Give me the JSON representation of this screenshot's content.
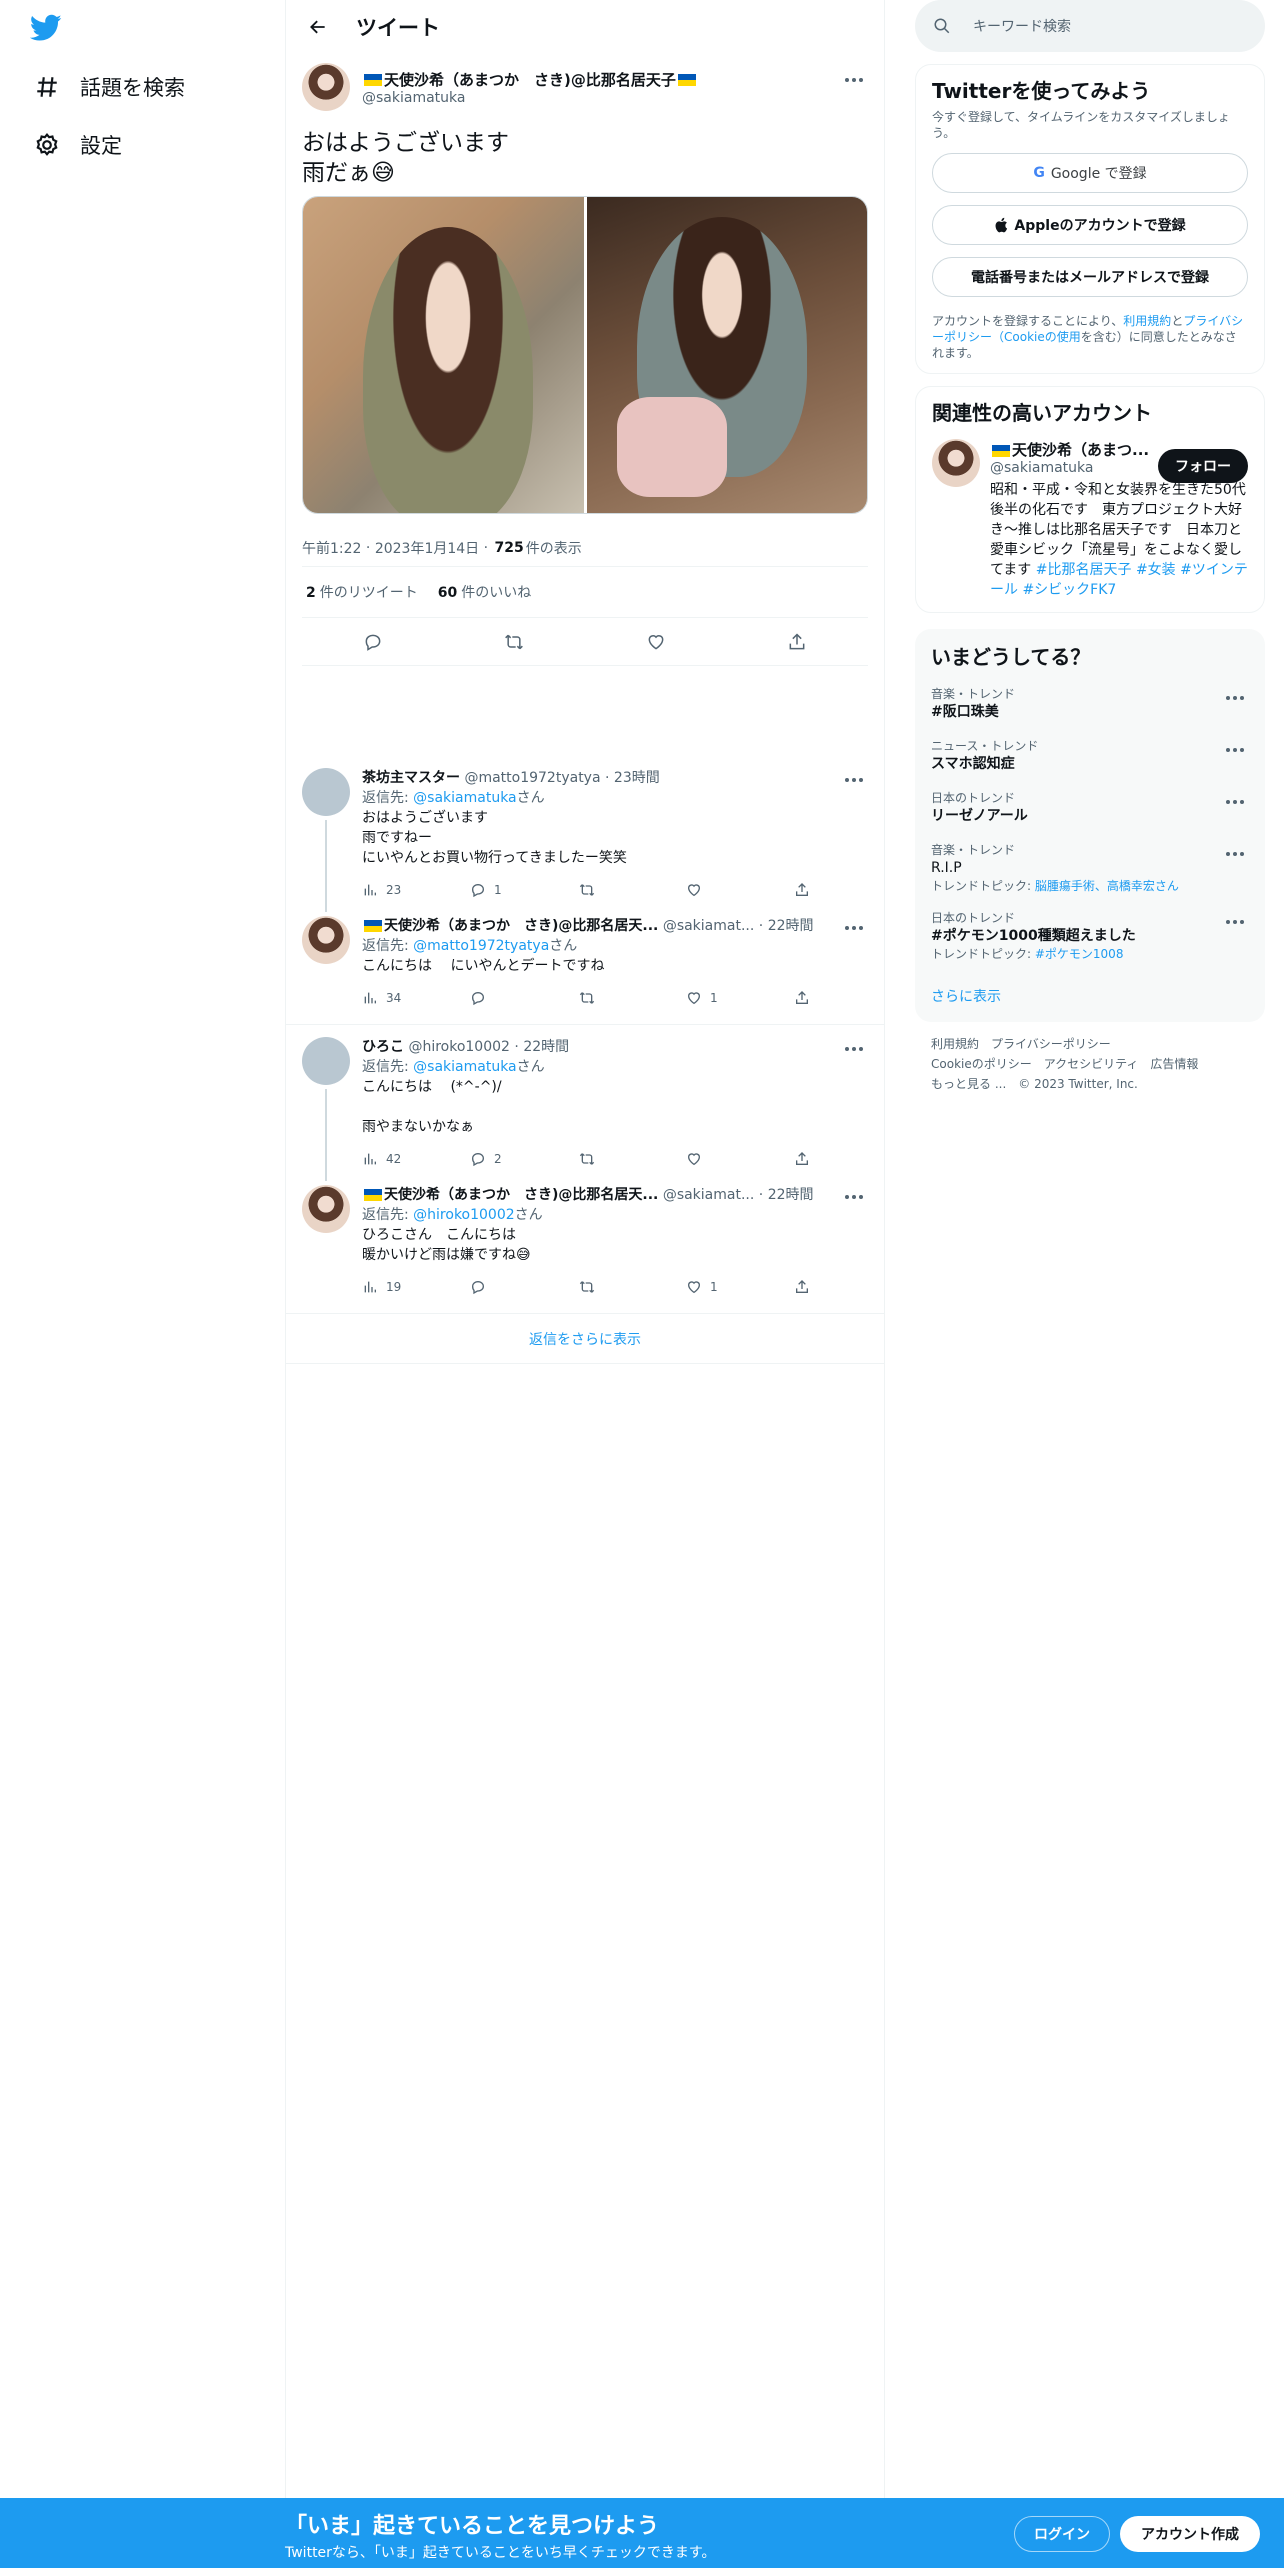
{
  "nav": {
    "explore_label": "話題を検索",
    "settings_label": "設定"
  },
  "header": {
    "title": "ツイート"
  },
  "tweet": {
    "author_name": "天使沙希（あまつか　さき)@比那名居天子",
    "author_handle": "@sakiamatuka",
    "text": "おはようございます\n雨だぁ😅",
    "time": "午前1:22",
    "date": "2023年1月14日",
    "views": "725",
    "views_label": "件の表示",
    "retweets": "2",
    "retweets_label": "件のリツイート",
    "likes": "60",
    "likes_label": "件のいいね"
  },
  "replies": [
    {
      "name": "茶坊主マスター",
      "handle": "@matto1972tyatya",
      "time": "23時間",
      "reply_prefix": "返信先: ",
      "reply_to": "@sakiamatuka",
      "reply_suffix": "さん",
      "text": "おはようございます\n雨ですねー\nにいやんとお買い物行ってきましたー笑笑",
      "views": "23",
      "replies": "1",
      "retweets": "",
      "likes": ""
    },
    {
      "name": "天使沙希（あまつか　さき)@比那名居天...",
      "handle": "@sakiamat...",
      "time": "22時間",
      "reply_prefix": "返信先: ",
      "reply_to": "@matto1972tyatya",
      "reply_suffix": "さん",
      "text": "こんにちは　 にいやんとデートですね",
      "views": "34",
      "replies": "",
      "retweets": "",
      "likes": "1"
    },
    {
      "name": "ひろこ",
      "handle": "@hiroko10002",
      "time": "22時間",
      "reply_prefix": "返信先: ",
      "reply_to": "@sakiamatuka",
      "reply_suffix": "さん",
      "text": "こんにちは　 (*^-^)/\n\n雨やまないかなぁ",
      "views": "42",
      "replies": "2",
      "retweets": "",
      "likes": ""
    },
    {
      "name": "天使沙希（あまつか　さき)@比那名居天...",
      "handle": "@sakiamat...",
      "time": "22時間",
      "reply_prefix": "返信先: ",
      "reply_to": "@hiroko10002",
      "reply_suffix": "さん",
      "text": "ひろこさん　こんにちは\n暖かいけど雨は嫌ですね😅",
      "views": "19",
      "replies": "",
      "retweets": "",
      "likes": "1"
    }
  ],
  "show_more_replies": "返信をさらに表示",
  "search": {
    "placeholder": "キーワード検索"
  },
  "signup_card": {
    "title": "Twitterを使ってみよう",
    "subtitle": "今すぐ登録して、タイムラインをカスタマイズしましょう。",
    "google_label": "Google で登録",
    "apple_label": "Appleのアカウントで登録",
    "phone_label": "電話番号またはメールアドレスで登録",
    "legal_1": "アカウントを登録することにより、",
    "legal_terms": "利用規約",
    "legal_2": "と",
    "legal_privacy": "プライバシーポリシー（Cookieの使用",
    "legal_3": "を含む）に同意したとみなされます。"
  },
  "related": {
    "title": "関連性の高いアカウント",
    "name": "天使沙希（あまつ...",
    "handle": "@sakiamatuka",
    "follow_label": "フォロー",
    "bio": "昭和・平成・令和と女装界を生きた50代後半の化石です　東方プロジェクト大好き～推しは比那名居天子です　日本刀と愛車シビック「流星号」をこよなく愛してます ",
    "bio_tags": "#比那名居天子 #女装 #ツインテール #シビックFK7"
  },
  "trends": {
    "title": "いまどうしてる？",
    "items": [
      {
        "category": "音楽・トレンド",
        "name": "#阪口珠美",
        "topic_label": "",
        "topics": ""
      },
      {
        "category": "ニュース・トレンド",
        "name": "スマホ認知症",
        "topic_label": "",
        "topics": ""
      },
      {
        "category": "日本のトレンド",
        "name": "リーゼノアール",
        "topic_label": "",
        "topics": ""
      },
      {
        "category": "音楽・トレンド",
        "name": "R.I.P",
        "topic_label": "トレンドトピック: ",
        "topics": "脳腫瘍手術、高橋幸宏さん"
      },
      {
        "category": "日本のトレンド",
        "name": "#ポケモン1000種類超えました",
        "topic_label": "トレンドトピック: ",
        "topics": "#ポケモン1008"
      }
    ],
    "show_more": "さらに表示"
  },
  "footer": {
    "terms": "利用規約",
    "privacy": "プライバシーポリシー",
    "cookie": "Cookieのポリシー",
    "accessibility": "アクセシビリティ",
    "ads": "広告情報",
    "more": "もっと見る ...",
    "copyright": "© 2023 Twitter, Inc."
  },
  "bottom_bar": {
    "headline": "「いま」起きていることを見つけよう",
    "subline": "Twitterなら、「いま」起きていることをいち早くチェックできます。",
    "login_label": "ログイン",
    "signup_label": "アカウント作成"
  },
  "colors": {
    "accent": "#1d9bf0",
    "text": "#0f1419",
    "secondary": "#536471"
  }
}
